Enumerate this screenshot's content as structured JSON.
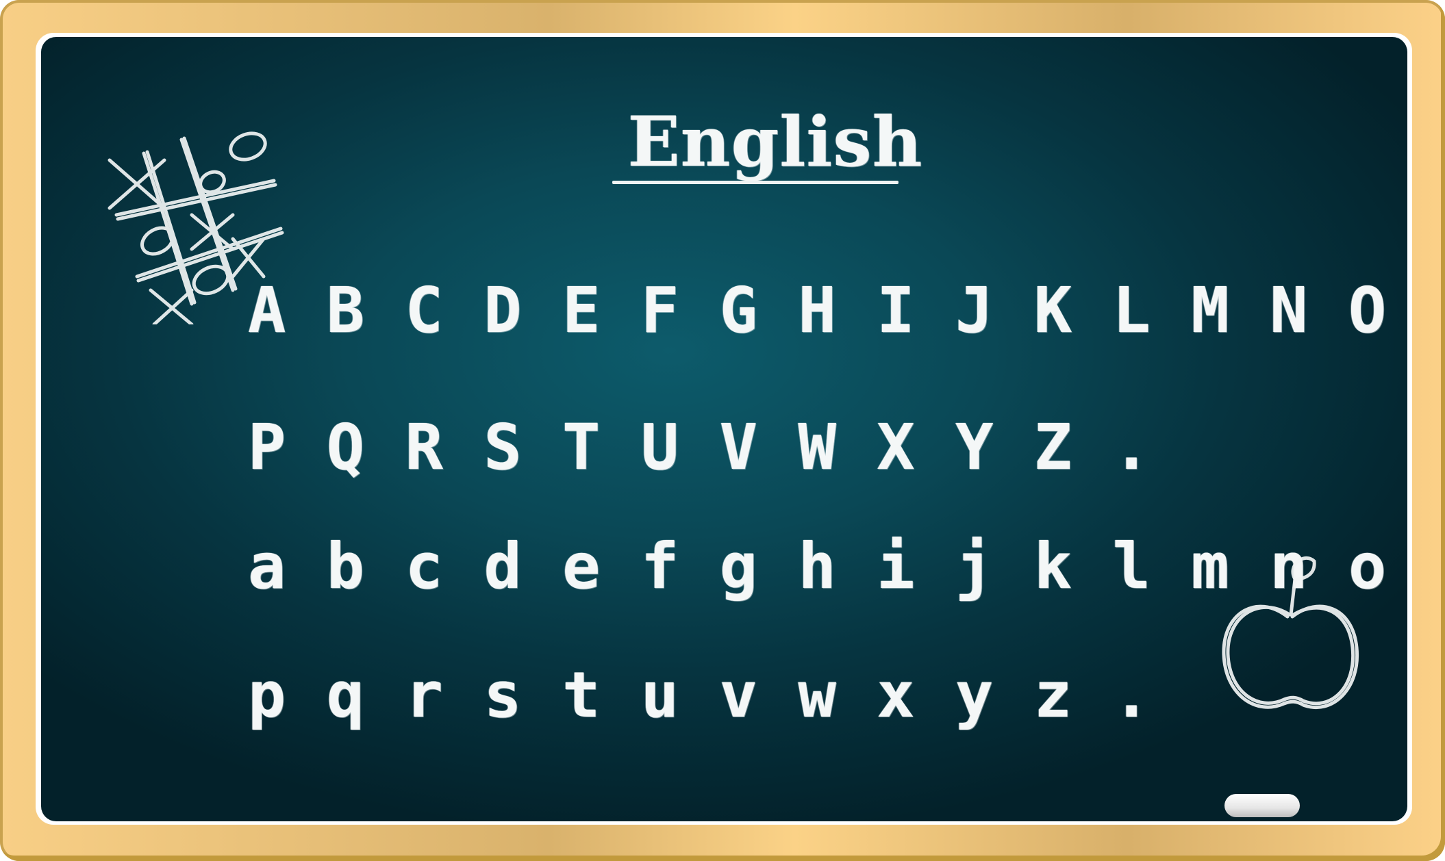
{
  "board": {
    "title": "English",
    "rows": [
      "A B C D E F G H I J K L M N O",
      "P Q R S T U V W X Y Z .",
      "a b c d e f g h i j k l m n o",
      "p q r s t u v w x y z ."
    ]
  },
  "decorations": {
    "game_icon": "tic-tac-toe-icon",
    "apple_icon": "apple-icon",
    "chalk_icon": "chalk-stick-icon"
  },
  "colors": {
    "board": "#0a4856",
    "frame": "#f8cf86",
    "chalk": "#f4f7f7"
  }
}
